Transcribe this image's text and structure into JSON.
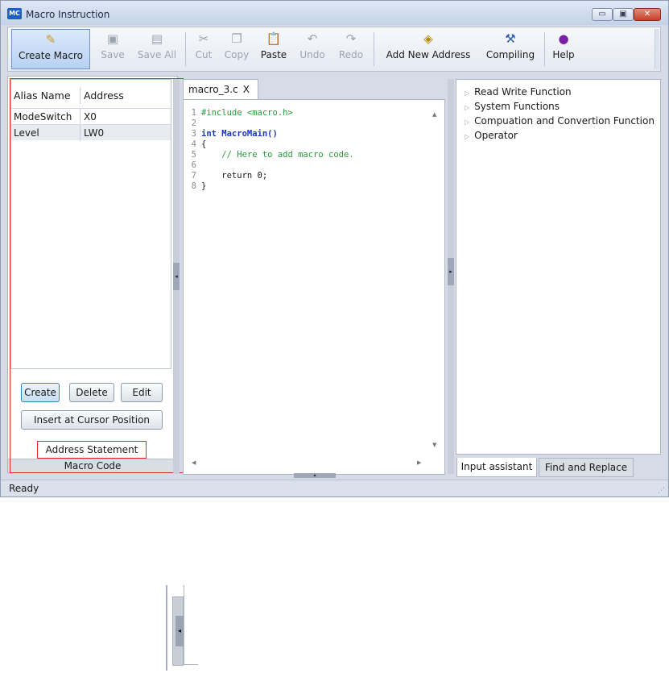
{
  "window": {
    "icon_text": "MC",
    "title": "Macro Instruction",
    "controls": {
      "minimize": "▭",
      "maximize": "▣",
      "close": "✕"
    }
  },
  "toolbar": {
    "create_macro": "Create Macro",
    "save": "Save",
    "save_all": "Save All",
    "cut": "Cut",
    "copy": "Copy",
    "paste": "Paste",
    "undo": "Undo",
    "redo": "Redo",
    "add_new_address": "Add New Address",
    "compiling": "Compiling",
    "help": "Help"
  },
  "variables": {
    "headers": [
      "Alias Name",
      "Address"
    ],
    "rows": [
      {
        "alias": "ModeSwitch",
        "address": "X0"
      },
      {
        "alias": "Level",
        "address": "LW0"
      }
    ]
  },
  "left_buttons": {
    "create": "Create",
    "delete": "Delete",
    "edit": "Edit",
    "insert": "Insert at Cursor Position",
    "address_statement": "Address Statement"
  },
  "left_tab": "Macro Code",
  "editor": {
    "tab_name": "macro_3.c",
    "tab_close": "X",
    "line_numbers": [
      "1",
      "2",
      "3",
      "4",
      "5",
      "6",
      "7",
      "8"
    ],
    "lines": [
      "#include <macro.h>",
      "",
      "int MacroMain()",
      "{",
      "    // Here to add macro code.",
      "",
      "    return 0;",
      "}"
    ]
  },
  "function_tree": [
    "Read Write Function",
    "System Functions",
    "Compuation and Convertion Function",
    "Operator"
  ],
  "right_tabs": {
    "input_assistant": "Input assistant",
    "find_replace": "Find and Replace"
  },
  "status": "Ready",
  "icons": {
    "toolbar": [
      "create-macro-icon",
      "save-icon",
      "save-all-icon",
      "cut-icon",
      "copy-icon",
      "paste-icon",
      "undo-icon",
      "redo-icon",
      "add-address-icon",
      "compile-icon",
      "help-icon"
    ]
  },
  "colors": {
    "highlight_frame": "#d92b2b",
    "keyword": "#1a35c8",
    "comment": "#2a9b3a"
  }
}
